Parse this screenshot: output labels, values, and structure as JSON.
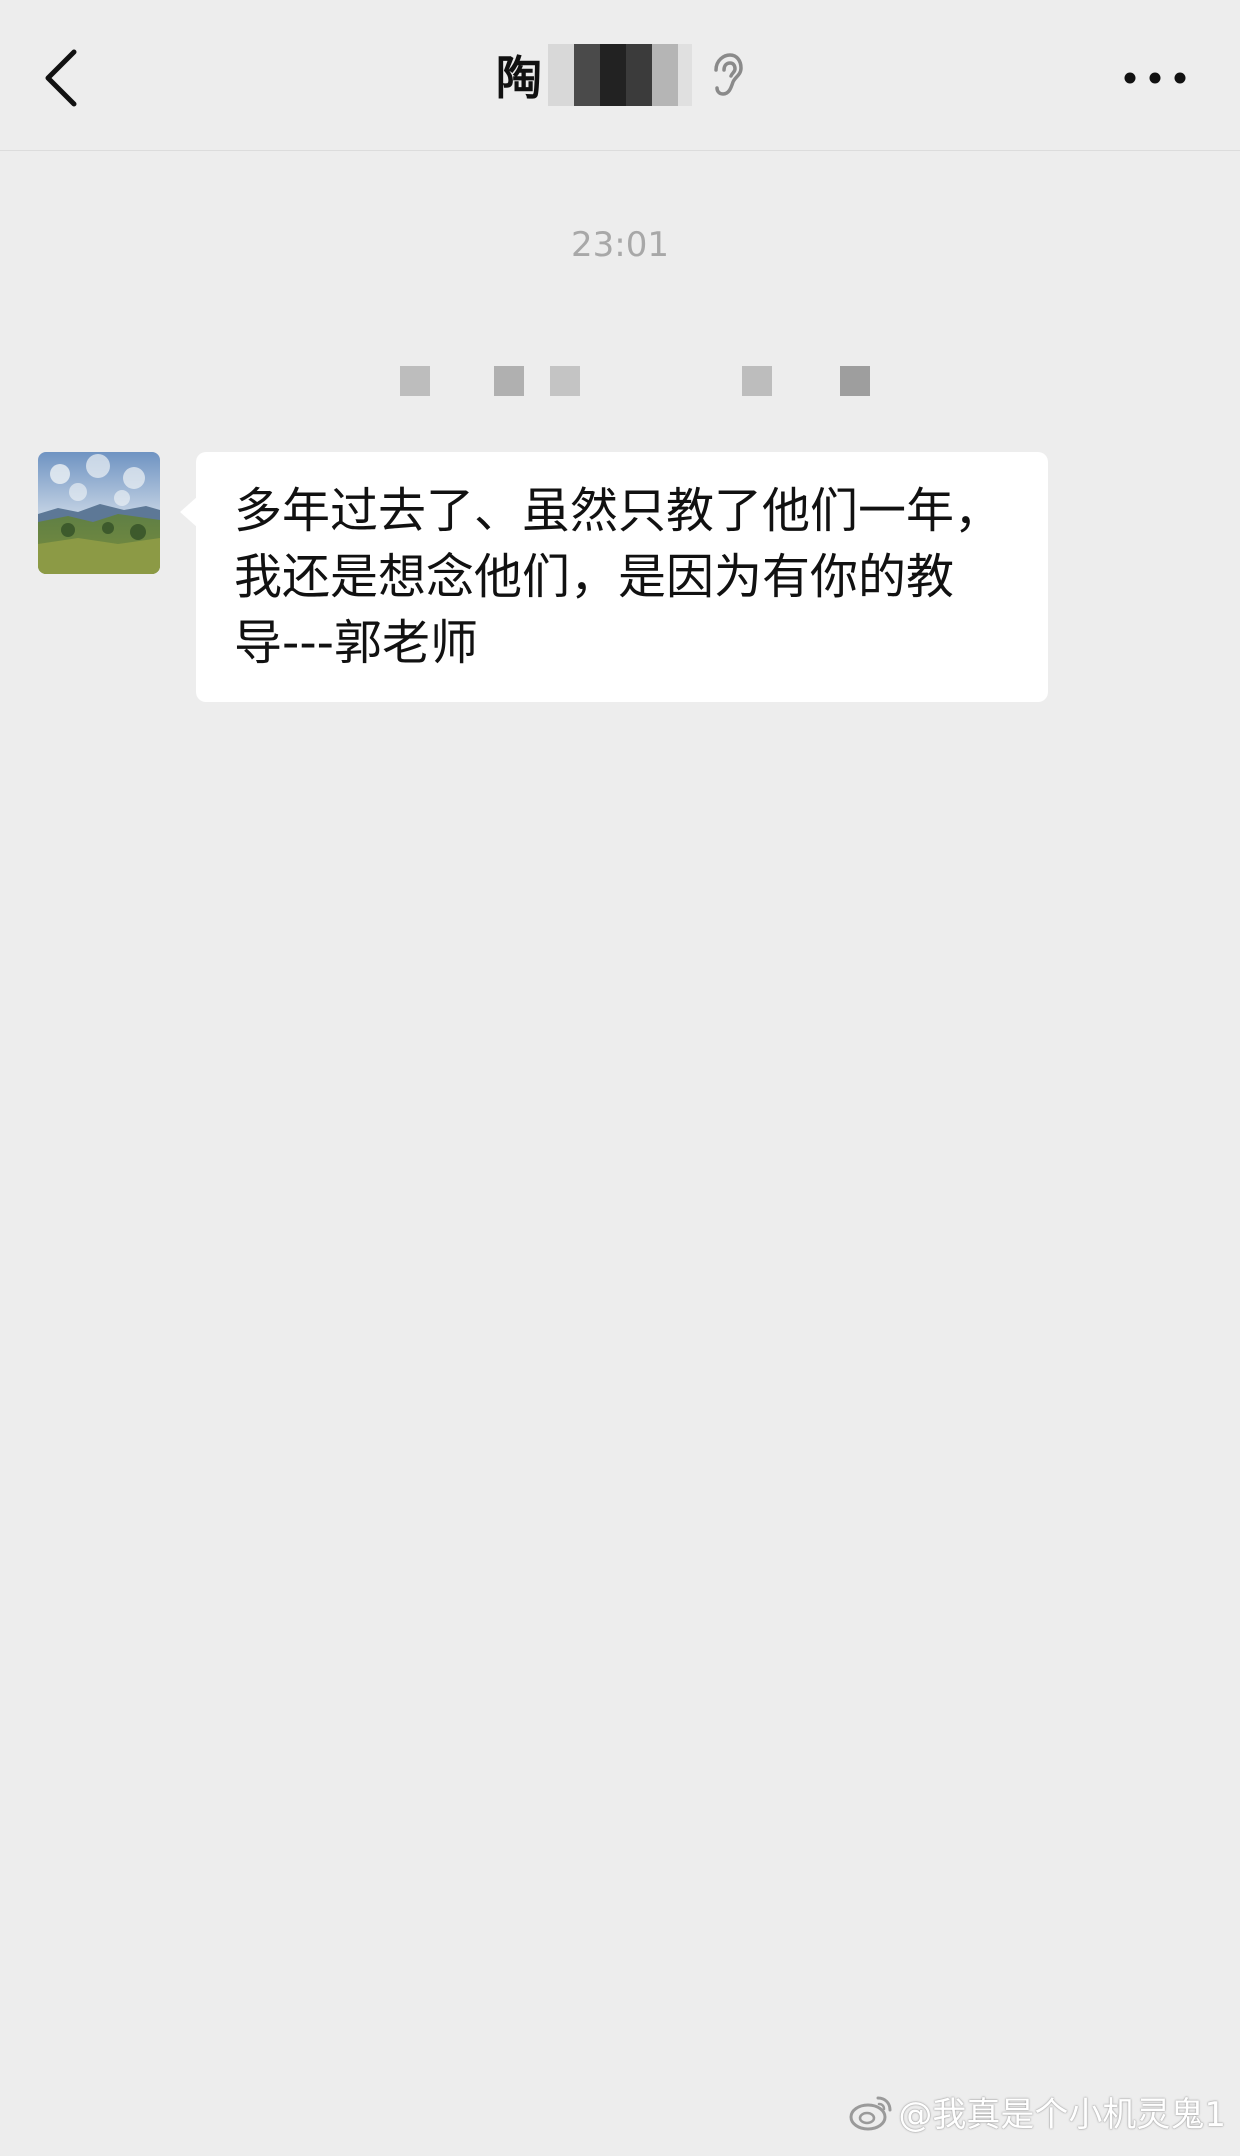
{
  "header": {
    "title": "陶",
    "ear_icon": "ear-icon",
    "back_icon": "chevron-left-icon",
    "more_icon": "more-dots-icon"
  },
  "chat": {
    "timestamp": "23:01",
    "messages": [
      {
        "sender": "other",
        "avatar_icon": "landscape-avatar",
        "text": "多年过去了、虽然只教了他们一年，我还是想念他们，是因为有你的教导---郭老师"
      }
    ]
  },
  "watermark": {
    "text": "@我真是个小机灵鬼1",
    "icon": "weibo-icon"
  },
  "colors": {
    "background": "#ededed",
    "bubble": "#ffffff",
    "timestamp": "#a8a8a8"
  }
}
